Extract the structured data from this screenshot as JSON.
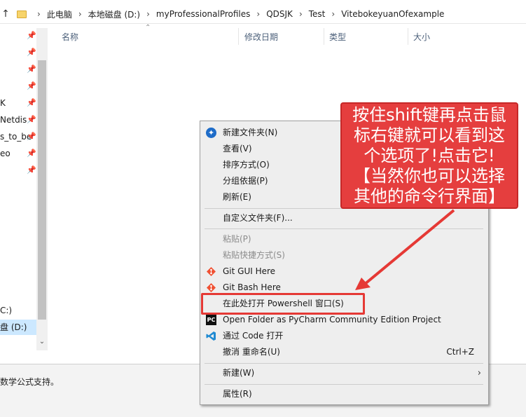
{
  "address_bar": {
    "up_arrow": "↑",
    "crumbs": [
      "此电脑",
      "本地磁盘 (D:)",
      "myProfessionalProfiles",
      "QDSJK",
      "Test",
      "VitebokeyuanOfexample"
    ],
    "separator": "›"
  },
  "columns": {
    "name": "名称",
    "modified": "修改日期",
    "type": "类型",
    "size": "大小"
  },
  "nav": {
    "items": [
      {
        "label": "",
        "pinned": true
      },
      {
        "label": "",
        "pinned": true
      },
      {
        "label": "",
        "pinned": true
      },
      {
        "label": "",
        "pinned": true
      },
      {
        "label": "K",
        "pinned": true
      },
      {
        "label": "Netdis",
        "pinned": true
      },
      {
        "label": "s_to_be",
        "pinned": true
      },
      {
        "label": "eo",
        "pinned": true
      },
      {
        "label": "",
        "pinned": true
      }
    ],
    "drive_c": "C:)",
    "drive_d": "盘 (D:)"
  },
  "status_text": "数学公式支持。",
  "context_menu": {
    "group1": [
      {
        "label": "新建文件夹(N)",
        "icon": "new-folder-icon"
      },
      {
        "label": "查看(V)"
      },
      {
        "label": "排序方式(O)"
      },
      {
        "label": "分组依据(P)"
      },
      {
        "label": "刷新(E)"
      }
    ],
    "group2": [
      {
        "label": "自定义文件夹(F)..."
      }
    ],
    "group3": [
      {
        "label": "粘贴(P)",
        "disabled": true
      },
      {
        "label": "粘贴快捷方式(S)",
        "disabled": true
      },
      {
        "label": "Git GUI Here",
        "icon": "git-icon"
      },
      {
        "label": "Git Bash Here",
        "icon": "git-icon"
      },
      {
        "label": "在此处打开 Powershell 窗口(S)"
      },
      {
        "label": "Open Folder as PyCharm Community Edition Project",
        "icon": "pycharm-icon"
      },
      {
        "label": "通过 Code 打开",
        "icon": "vscode-icon"
      },
      {
        "label": "撤消 重命名(U)",
        "accelerator": "Ctrl+Z"
      }
    ],
    "group4": [
      {
        "label": "新建(W)",
        "submenu": "›"
      }
    ],
    "group5": [
      {
        "label": "属性(R)"
      }
    ]
  },
  "callout": {
    "lines": [
      "按住shift键再点击鼠",
      "标右键就可以看到这",
      "个选项了!点击它!",
      "【当然你也可以选择",
      "其他的命令行界面】"
    ]
  },
  "colors": {
    "callout_red": "#e53e3e",
    "highlight_red": "#e53935",
    "menu_bg": "#eeeeee"
  }
}
